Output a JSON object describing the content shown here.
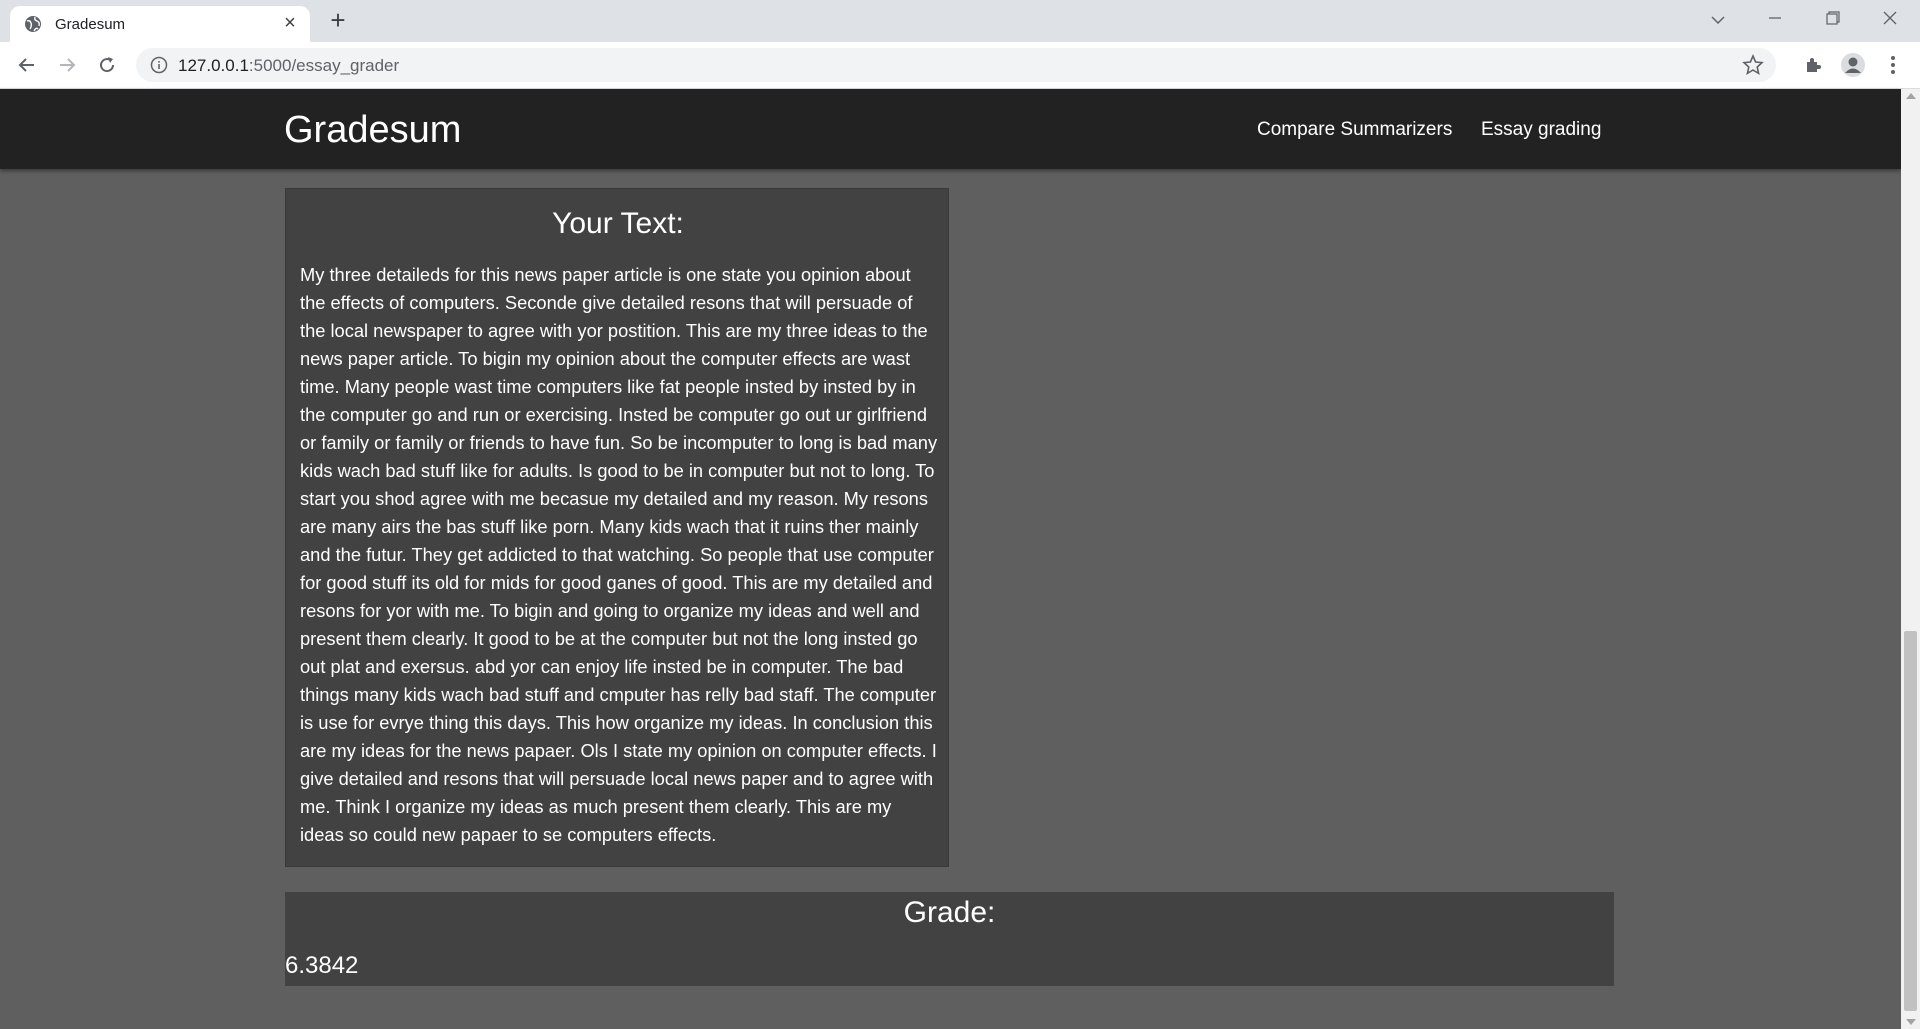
{
  "browser": {
    "tab": {
      "title": "Gradesum",
      "icon": "globe-icon"
    },
    "address": {
      "host": "127.0.0.1",
      "rest": ":5000/essay_grader"
    },
    "window_controls": [
      "chevron-down-icon",
      "minimize-icon",
      "restore-icon",
      "close-icon"
    ]
  },
  "navbar": {
    "brand": "Gradesum",
    "links": [
      {
        "label": "Compare Summarizers"
      },
      {
        "label": "Essay grading"
      }
    ]
  },
  "text_card": {
    "heading": "Your Text:",
    "essay": "My three detaileds for this news paper article is one state you opinion about the effects of computers. Seconde give detailed resons that will persuade of the local newspaper to agree with yor postition. This are my three ideas to the news paper article. To bigin my opinion about the computer effects are wast time. Many people wast time computers like fat people insted by insted by in the computer go and run or exercising. Insted be computer go out ur girlfriend or family or family or friends to have fun. So be incomputer to long is bad many kids wach bad stuff like for adults. Is good to be in computer but not to long. To start you shod agree with me becasue my detailed and my reason. My resons are many airs the bas stuff like porn. Many kids wach that it ruins ther mainly and the futur. They get addicted to that watching. So people that use computer for good stuff its old for mids for good ganes of good. This are my detailed and resons for yor with me. To bigin and going to organize my ideas and well and present them clearly. It good to be at the computer but not the long insted go out plat and exersus. abd yor can enjoy life insted be in computer. The bad things many kids wach bad stuff and cmputer has relly bad staff. The computer is use for evrye thing this days. This how organize my ideas. In conclusion this are my ideas for the news papaer. Ols I state my opinion on computer effects. I give detailed and resons that will persuade local news paper and to agree with me. Think I organize my ideas as much present them clearly. This are my ideas so could new papaer to se computers effects."
  },
  "grade_card": {
    "heading": "Grade:",
    "value": "6.3842"
  }
}
